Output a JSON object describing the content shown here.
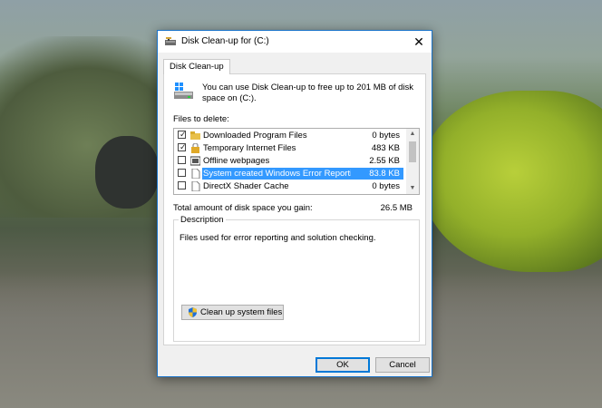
{
  "window": {
    "title": "Disk Clean-up for  (C:)",
    "close_glyph": "✕"
  },
  "tab": {
    "label": "Disk Clean-up"
  },
  "intro_text": "You can use Disk Clean-up to free up to 201 MB of disk space on  (C:).",
  "files_label": "Files to delete:",
  "files": [
    {
      "checked": true,
      "icon": "folder-icon",
      "name": "Downloaded Program Files",
      "size": "0 bytes",
      "selected": false
    },
    {
      "checked": true,
      "icon": "lock-icon",
      "name": "Temporary Internet Files",
      "size": "483 KB",
      "selected": false
    },
    {
      "checked": false,
      "icon": "offline-icon",
      "name": "Offline webpages",
      "size": "2.55 KB",
      "selected": false
    },
    {
      "checked": false,
      "icon": "document-icon",
      "name": "System created Windows Error Reporti...",
      "size": "83.8 KB",
      "selected": true
    },
    {
      "checked": false,
      "icon": "document-icon",
      "name": "DirectX Shader Cache",
      "size": "0 bytes",
      "selected": false
    }
  ],
  "check_glyph": "✓",
  "scroll": {
    "up": "▲",
    "down": "▼"
  },
  "total_label": "Total amount of disk space you gain:",
  "total_value": "26.5 MB",
  "description": {
    "legend": "Description",
    "text": "Files used for error reporting and solution checking."
  },
  "cleanup_button": "Clean up system files",
  "ok_button": "OK",
  "cancel_button": "Cancel",
  "colors": {
    "accent": "#0078d7",
    "selection": "#3399ff"
  }
}
